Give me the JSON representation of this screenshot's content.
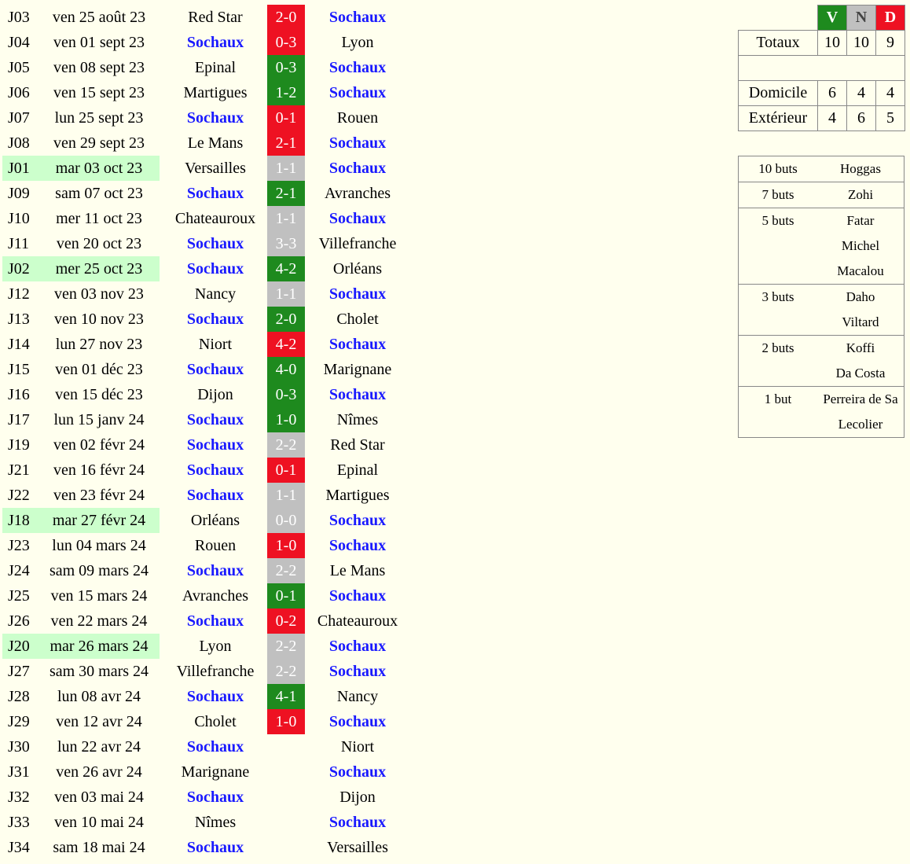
{
  "team": "Sochaux",
  "matches": [
    {
      "round": "J03",
      "date": "ven 25 août 23",
      "home": "Red Star",
      "away": "Sochaux",
      "score": "2-0",
      "result": "D",
      "hl": false
    },
    {
      "round": "J04",
      "date": "ven 01 sept 23",
      "home": "Sochaux",
      "away": "Lyon",
      "score": "0-3",
      "result": "D",
      "hl": false
    },
    {
      "round": "J05",
      "date": "ven 08 sept 23",
      "home": "Epinal",
      "away": "Sochaux",
      "score": "0-3",
      "result": "V",
      "hl": false
    },
    {
      "round": "J06",
      "date": "ven 15 sept 23",
      "home": "Martigues",
      "away": "Sochaux",
      "score": "1-2",
      "result": "V",
      "hl": false
    },
    {
      "round": "J07",
      "date": "lun 25 sept 23",
      "home": "Sochaux",
      "away": "Rouen",
      "score": "0-1",
      "result": "D",
      "hl": false
    },
    {
      "round": "J08",
      "date": "ven 29 sept 23",
      "home": "Le Mans",
      "away": "Sochaux",
      "score": "2-1",
      "result": "D",
      "hl": false
    },
    {
      "round": "J01",
      "date": "mar 03 oct 23",
      "home": "Versailles",
      "away": "Sochaux",
      "score": "1-1",
      "result": "N",
      "hl": true
    },
    {
      "round": "J09",
      "date": "sam 07 oct 23",
      "home": "Sochaux",
      "away": "Avranches",
      "score": "2-1",
      "result": "V",
      "hl": false
    },
    {
      "round": "J10",
      "date": "mer 11 oct 23",
      "home": "Chateauroux",
      "away": "Sochaux",
      "score": "1-1",
      "result": "N",
      "hl": false
    },
    {
      "round": "J11",
      "date": "ven 20 oct 23",
      "home": "Sochaux",
      "away": "Villefranche",
      "score": "3-3",
      "result": "N",
      "hl": false
    },
    {
      "round": "J02",
      "date": "mer 25 oct 23",
      "home": "Sochaux",
      "away": "Orléans",
      "score": "4-2",
      "result": "V",
      "hl": true
    },
    {
      "round": "J12",
      "date": "ven 03 nov 23",
      "home": "Nancy",
      "away": "Sochaux",
      "score": "1-1",
      "result": "N",
      "hl": false
    },
    {
      "round": "J13",
      "date": "ven 10 nov 23",
      "home": "Sochaux",
      "away": "Cholet",
      "score": "2-0",
      "result": "V",
      "hl": false
    },
    {
      "round": "J14",
      "date": "lun 27 nov 23",
      "home": "Niort",
      "away": "Sochaux",
      "score": "4-2",
      "result": "D",
      "hl": false
    },
    {
      "round": "J15",
      "date": "ven 01 déc 23",
      "home": "Sochaux",
      "away": "Marignane",
      "score": "4-0",
      "result": "V",
      "hl": false
    },
    {
      "round": "J16",
      "date": "ven 15 déc 23",
      "home": "Dijon",
      "away": "Sochaux",
      "score": "0-3",
      "result": "V",
      "hl": false
    },
    {
      "round": "J17",
      "date": "lun 15 janv 24",
      "home": "Sochaux",
      "away": "Nîmes",
      "score": "1-0",
      "result": "V",
      "hl": false
    },
    {
      "round": "J19",
      "date": "ven 02 févr 24",
      "home": "Sochaux",
      "away": "Red Star",
      "score": "2-2",
      "result": "N",
      "hl": false
    },
    {
      "round": "J21",
      "date": "ven 16 févr 24",
      "home": "Sochaux",
      "away": "Epinal",
      "score": "0-1",
      "result": "D",
      "hl": false
    },
    {
      "round": "J22",
      "date": "ven 23 févr 24",
      "home": "Sochaux",
      "away": "Martigues",
      "score": "1-1",
      "result": "N",
      "hl": false
    },
    {
      "round": "J18",
      "date": "mar 27 févr 24",
      "home": "Orléans",
      "away": "Sochaux",
      "score": "0-0",
      "result": "N",
      "hl": true
    },
    {
      "round": "J23",
      "date": "lun 04 mars 24",
      "home": "Rouen",
      "away": "Sochaux",
      "score": "1-0",
      "result": "D",
      "hl": false
    },
    {
      "round": "J24",
      "date": "sam 09 mars 24",
      "home": "Sochaux",
      "away": "Le Mans",
      "score": "2-2",
      "result": "N",
      "hl": false
    },
    {
      "round": "J25",
      "date": "ven 15 mars 24",
      "home": "Avranches",
      "away": "Sochaux",
      "score": "0-1",
      "result": "V",
      "hl": false
    },
    {
      "round": "J26",
      "date": "ven 22 mars 24",
      "home": "Sochaux",
      "away": "Chateauroux",
      "score": "0-2",
      "result": "D",
      "hl": false
    },
    {
      "round": "J20",
      "date": "mar 26 mars 24",
      "home": "Lyon",
      "away": "Sochaux",
      "score": "2-2",
      "result": "N",
      "hl": true
    },
    {
      "round": "J27",
      "date": "sam 30 mars 24",
      "home": "Villefranche",
      "away": "Sochaux",
      "score": "2-2",
      "result": "N",
      "hl": false
    },
    {
      "round": "J28",
      "date": "lun 08 avr 24",
      "home": "Sochaux",
      "away": "Nancy",
      "score": "4-1",
      "result": "V",
      "hl": false
    },
    {
      "round": "J29",
      "date": "ven 12 avr 24",
      "home": "Cholet",
      "away": "Sochaux",
      "score": "1-0",
      "result": "D",
      "hl": false
    },
    {
      "round": "J30",
      "date": "lun 22 avr 24",
      "home": "Sochaux",
      "away": "Niort",
      "score": "",
      "result": "",
      "hl": false
    },
    {
      "round": "J31",
      "date": "ven 26 avr 24",
      "home": "Marignane",
      "away": "Sochaux",
      "score": "",
      "result": "",
      "hl": false
    },
    {
      "round": "J32",
      "date": "ven 03 mai 24",
      "home": "Sochaux",
      "away": "Dijon",
      "score": "",
      "result": "",
      "hl": false
    },
    {
      "round": "J33",
      "date": "ven 10 mai 24",
      "home": "Nîmes",
      "away": "Sochaux",
      "score": "",
      "result": "",
      "hl": false
    },
    {
      "round": "J34",
      "date": "sam 18 mai 24",
      "home": "Sochaux",
      "away": "Versailles",
      "score": "",
      "result": "",
      "hl": false
    }
  ],
  "summary": {
    "headers": {
      "v": "V",
      "n": "N",
      "d": "D"
    },
    "colors": {
      "v": "#1e8a1e",
      "n": "#c0c0c0",
      "d": "#ee1122"
    },
    "totals": {
      "label": "Totaux",
      "v": "10",
      "n": "10",
      "d": "9"
    },
    "home": {
      "label": "Domicile",
      "v": "6",
      "n": "4",
      "d": "4"
    },
    "away": {
      "label": "Extérieur",
      "v": "4",
      "n": "6",
      "d": "5"
    }
  },
  "scorers": [
    {
      "goals": "10 buts",
      "names": [
        "Hoggas"
      ]
    },
    {
      "goals": "7 buts",
      "names": [
        "Zohi"
      ]
    },
    {
      "goals": "5 buts",
      "names": [
        "Fatar",
        "Michel",
        "Macalou"
      ]
    },
    {
      "goals": "3 buts",
      "names": [
        "Daho",
        "Viltard"
      ]
    },
    {
      "goals": "2 buts",
      "names": [
        "Koffi",
        "Da Costa"
      ]
    },
    {
      "goals": "1 but",
      "names": [
        "Perreira de Sa",
        "Lecolier"
      ]
    }
  ]
}
